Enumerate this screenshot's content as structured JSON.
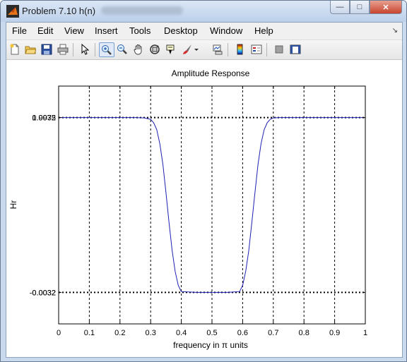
{
  "window": {
    "title": "Problem 7.10 h(n)",
    "controls": {
      "minimize": "—",
      "maximize": "□",
      "close": "✕"
    }
  },
  "menubar": {
    "items": [
      "File",
      "Edit",
      "View",
      "Insert",
      "Tools",
      "Desktop",
      "Window",
      "Help"
    ],
    "dock_arrow": "↘"
  },
  "toolbar": {
    "icons": [
      "new-figure-icon",
      "open-file-icon",
      "save-icon",
      "print-icon",
      "edit-plot-arrow-icon",
      "zoom-in-icon",
      "zoom-out-icon",
      "pan-hand-icon",
      "rotate-3d-icon",
      "data-cursor-icon",
      "brush-icon",
      "brush-dropdown-icon",
      "link-plot-icon",
      "colorbar-icon",
      "legend-icon",
      "hide-plot-tools-icon",
      "show-plot-tools-icon"
    ],
    "active": "zoom-in-icon"
  },
  "chart_data": {
    "type": "line",
    "title": "Amplitude Response",
    "xlabel": "frequency in π units",
    "ylabel": "Hr",
    "xlim": [
      0,
      1
    ],
    "ylim": [
      -0.18,
      1.18
    ],
    "xticks": [
      "0",
      "0.1",
      "0.2",
      "0.3",
      "0.4",
      "0.5",
      "0.6",
      "0.7",
      "0.8",
      "0.9",
      "1"
    ],
    "ytick_labels": [
      "0.9975",
      "1.0032",
      "-0.0032",
      "0.0032"
    ],
    "ytick_positions": [
      1.0,
      1.0,
      0.0,
      0.0
    ],
    "grid": true,
    "colors": {
      "series": "#1f1fb4",
      "grid": "#000000"
    },
    "series": [
      {
        "x": [
          0,
          0.05,
          0.1,
          0.15,
          0.2,
          0.25,
          0.28,
          0.3,
          0.31,
          0.32,
          0.33,
          0.34,
          0.35,
          0.36,
          0.37,
          0.38,
          0.39,
          0.4,
          0.45,
          0.5,
          0.55,
          0.59,
          0.6,
          0.61,
          0.62,
          0.63,
          0.64,
          0.65,
          0.66,
          0.67,
          0.68,
          0.69,
          0.7,
          0.72,
          0.75,
          0.8,
          0.85,
          0.9,
          0.95,
          1.0
        ],
        "y": [
          1.0,
          1.0,
          1.0,
          1.0,
          1.0,
          1.0,
          0.998,
          0.99,
          0.97,
          0.93,
          0.85,
          0.73,
          0.57,
          0.4,
          0.24,
          0.12,
          0.04,
          0.005,
          0.0,
          0.0,
          0.0,
          0.005,
          0.04,
          0.12,
          0.24,
          0.4,
          0.57,
          0.73,
          0.85,
          0.93,
          0.97,
          0.99,
          0.998,
          1.0,
          1.0,
          1.0,
          1.0,
          1.0,
          1.0,
          1.0
        ]
      }
    ]
  }
}
